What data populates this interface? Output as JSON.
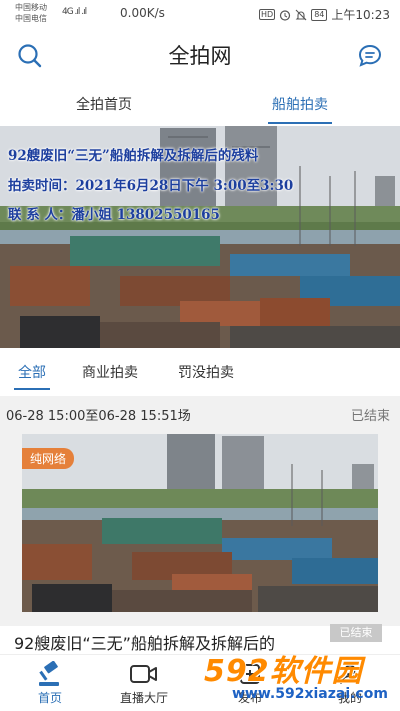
{
  "status_bar": {
    "carrier_1": "中国移动",
    "carrier_2": "中国电信",
    "signal": "4G .ıl .ıl",
    "speed": "0.00K/s",
    "hd": "HD",
    "battery": "84",
    "time": "上午10:23"
  },
  "header": {
    "title": "全拍网",
    "search_icon": "search-icon",
    "message_icon": "chat-bubble-icon"
  },
  "top_tabs": [
    {
      "label": "全拍首页",
      "active": false
    },
    {
      "label": "船舶拍卖",
      "active": true
    }
  ],
  "banner": {
    "line1": "92艘废旧“三无”船舶拆解及拆解后的残料",
    "line2": "拍卖时间：2021年6月28日下午 3:00至3:30",
    "line3": "联 系 人：潘小姐 13802550165"
  },
  "sub_tabs": [
    {
      "label": "全部",
      "active": true
    },
    {
      "label": "商业拍卖",
      "active": false
    },
    {
      "label": "罚没拍卖",
      "active": false
    }
  ],
  "auction_card": {
    "session_time": "06-28 15:00至06-28 15:51场",
    "session_status": "已结束",
    "tag": "纯网络",
    "title": "92艘废旧“三无”船舶拆解及拆解后的",
    "status_badge": "已结束"
  },
  "bottom_nav": [
    {
      "label": "首页",
      "icon": "gavel-icon",
      "active": true
    },
    {
      "label": "直播大厅",
      "icon": "video-camera-icon",
      "active": false
    },
    {
      "label": "发布",
      "icon": "publish-icon",
      "active": false
    },
    {
      "label": "我的",
      "icon": "user-icon",
      "active": false
    }
  ],
  "watermark": {
    "main": "592软件园",
    "url": "www.592xiazai.com"
  },
  "colors": {
    "accent": "#2b6fb5",
    "tag": "#e5803a",
    "banner_text": "#1d3f9e",
    "watermark_orange": "#ff8a00",
    "watermark_blue": "#1e62c4"
  }
}
